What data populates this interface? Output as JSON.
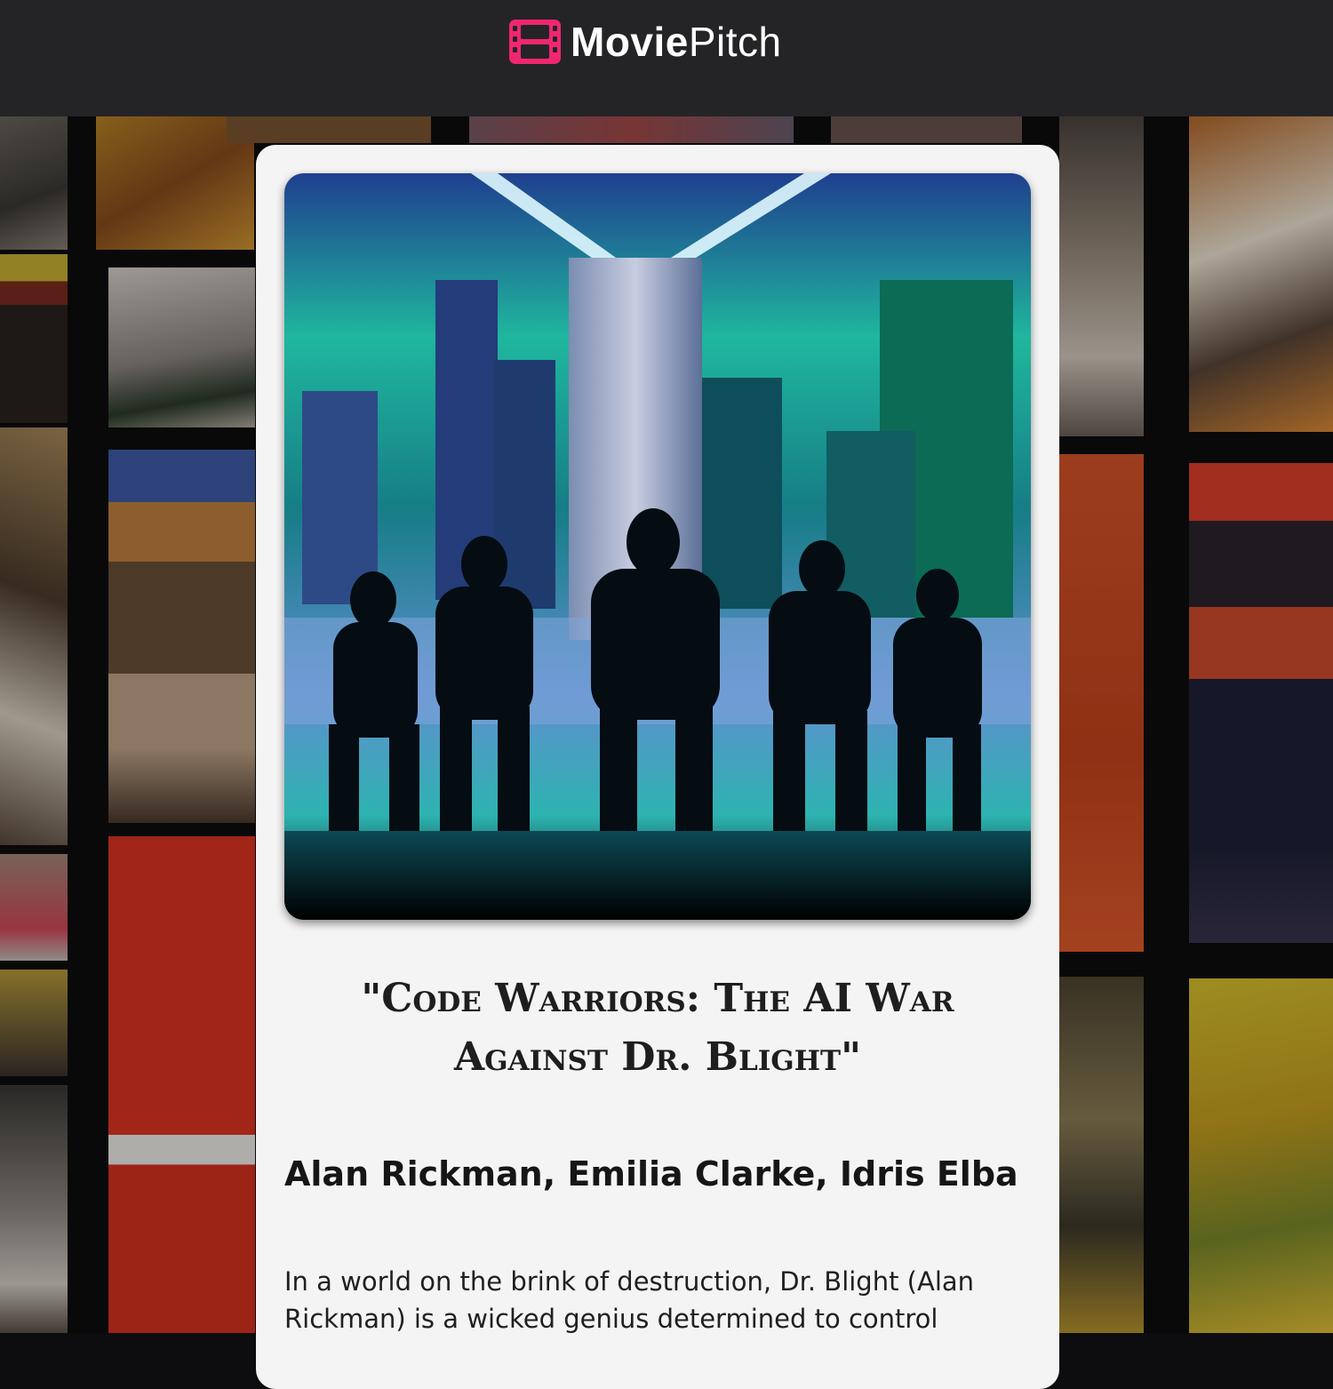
{
  "app": {
    "brand_bold": "Movie",
    "brand_light": "Pitch",
    "logo_icon": "film-strip-icon",
    "accent_color": "#f0266e"
  },
  "pitch": {
    "poster_image": "city-skyline-cyborg-warriors-poster",
    "title": "\"Code Warriors: The AI War Against Dr. Blight\"",
    "cast": "Alan Rickman, Emilia Clarke, Idris Elba",
    "synopsis": "In a world on the brink of destruction, Dr. Blight (Alan Rickman) is a wicked genius determined to control"
  },
  "colors": {
    "header_bg": "#242427",
    "card_bg": "#f4f4f4",
    "text": "#1e1e1e"
  }
}
